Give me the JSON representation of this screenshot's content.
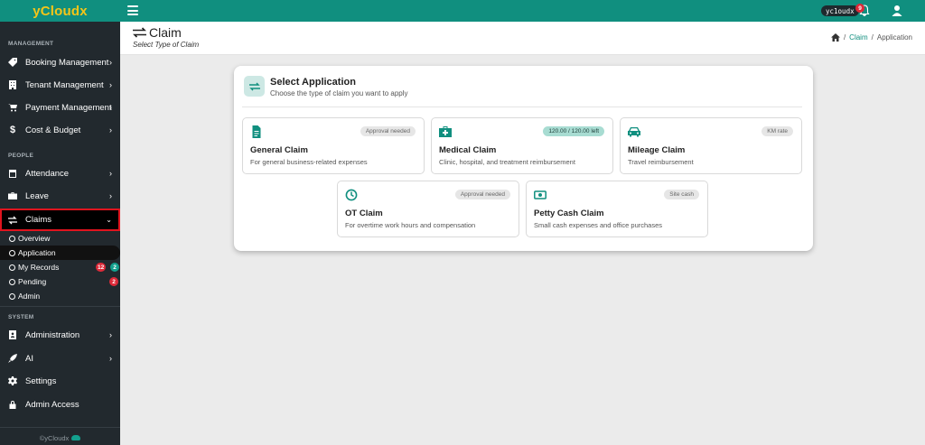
{
  "brand": {
    "name": "yCloudx"
  },
  "sidebar": {
    "sections": {
      "management": "MANAGEMENT",
      "people": "PEOPLE",
      "system": "SYSTEM"
    },
    "items": [
      {
        "label": "Booking Management",
        "icon": "tag-icon"
      },
      {
        "label": "Tenant Management",
        "icon": "building-icon"
      },
      {
        "label": "Payment Management",
        "icon": "cart-icon"
      },
      {
        "label": "Cost & Budget",
        "icon": "dollar-icon"
      },
      {
        "label": "Attendance",
        "icon": "calendar-icon"
      },
      {
        "label": "Leave",
        "icon": "briefcase-icon"
      },
      {
        "label": "Claims",
        "icon": "exchange-icon"
      },
      {
        "label": "Administration",
        "icon": "id-card-icon"
      },
      {
        "label": "AI",
        "icon": "rocket-icon"
      },
      {
        "label": "Settings",
        "icon": "gear-icon"
      },
      {
        "label": "Admin Access",
        "icon": "lock-icon"
      }
    ],
    "claims_sub": [
      {
        "label": "Overview"
      },
      {
        "label": "Application"
      },
      {
        "label": "My Records",
        "badge_red": "12",
        "badge_teal": "2"
      },
      {
        "label": "Pending",
        "badge_red": "2"
      },
      {
        "label": "Admin"
      }
    ],
    "footer": "©yCloudx"
  },
  "topbar": {
    "user": "yc1oudx",
    "notification_count": "9"
  },
  "page": {
    "title": "Claim",
    "subtitle": "Select Type of Claim",
    "breadcrumb": {
      "section": "Claim",
      "current": "Application",
      "sep": "/"
    }
  },
  "card": {
    "title": "Select Application",
    "subtitle": "Choose the type of claim you want to apply",
    "options": [
      {
        "title": "General Claim",
        "desc": "For general business-related expenses",
        "badge": "Approval needed",
        "icon": "file-icon"
      },
      {
        "title": "Medical Claim",
        "desc": "Clinic, hospital, and treatment reimbursement",
        "badge": "120.00 / 120.00 left",
        "icon": "medkit-icon"
      },
      {
        "title": "Mileage Claim",
        "desc": "Travel reimbursement",
        "badge": "KM rate",
        "icon": "car-icon"
      },
      {
        "title": "OT Claim",
        "desc": "For overtime work hours and compensation",
        "badge": "Approval needed",
        "icon": "clock-icon"
      },
      {
        "title": "Petty Cash Claim",
        "desc": "Small cash expenses and office purchases",
        "badge": "Site cash",
        "icon": "money-icon"
      }
    ]
  },
  "colors": {
    "accent": "#108f7f",
    "sidebar": "#22292e",
    "brand_text": "#f5c518",
    "danger": "#dd2a39"
  }
}
